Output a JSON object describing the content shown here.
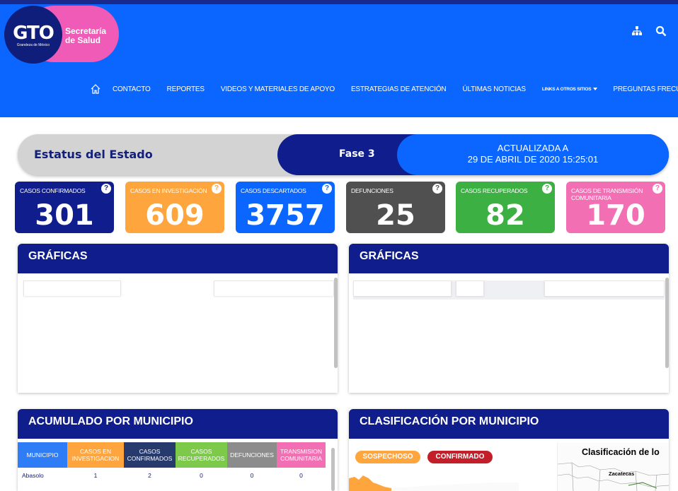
{
  "header": {
    "logo": {
      "brand": "GTO",
      "tagline": "Grandeza de México",
      "name_line1": "Secretaría",
      "name_line2": "de Salud"
    },
    "nav": [
      {
        "label": "CONTACTO"
      },
      {
        "label": "REPORTES"
      },
      {
        "label": "VIDEOS Y MATERIALES DE APOYO"
      },
      {
        "label": "ESTRATEGIAS DE ATENCIÓN"
      },
      {
        "label": "ÚLTIMAS NOTICIAS"
      },
      {
        "label": "LINKS A OTROS SITIOS"
      },
      {
        "label": "PREGUNTAS FRECUENTES"
      }
    ],
    "icons": [
      "sitemap-icon",
      "search-icon",
      "home-icon"
    ]
  },
  "status": {
    "title": "Estatus del Estado",
    "phase": "Fase 3",
    "updated_line1": "ACTUALIZADA A",
    "updated_line2": "29 DE ABRIL DE 2020 15:25:01"
  },
  "cards": [
    {
      "label": "CASOS CONFIRMADOS",
      "value": "301",
      "color": "#0f1e8c"
    },
    {
      "label": "CASOS EN INVESTIGACIÓN",
      "value": "609",
      "color": "#ffa53d"
    },
    {
      "label": "CASOS DESCARTADOS",
      "value": "3757",
      "color": "#0a66ff"
    },
    {
      "label": "DEFUNCIONES",
      "value": "25",
      "color": "#505050"
    },
    {
      "label": "CASOS RECUPERADOS",
      "value": "82",
      "color": "#3cb043"
    },
    {
      "label": "CASOS DE TRANSMISIÓN COMUNITARIA",
      "value": "170",
      "color": "#f36fb4"
    }
  ],
  "card_help": "?",
  "panels": {
    "graficas_left": "GRÁFICAS",
    "graficas_right": "GRÁFICAS",
    "acumulado": "ACUMULADO POR MUNICIPIO",
    "clasificacion": "CLASIFICACIÓN POR MUNICIPIO"
  },
  "table": {
    "headers": [
      "MUNICIPIO",
      "CASOS EN INVESTIGACION",
      "CASOS CONFIRMADOS",
      "CASOS RECUPERADOS",
      "DEFUNCIONES",
      "TRANSMISION COMUNITARIA"
    ],
    "header_colors": [
      "#2f7df6",
      "#ffa53d",
      "#273a6e",
      "#7dc94a",
      "#8c8c8c",
      "#f36fb4"
    ],
    "rows": [
      [
        "Abasolo",
        "1",
        "2",
        "0",
        "0",
        "0"
      ]
    ]
  },
  "legend": {
    "sospechoso": "SOSPECHOSO",
    "confirmado": "CONFIRMADO"
  },
  "map": {
    "title": "Clasificación de lo",
    "place": "Zacatecas"
  }
}
